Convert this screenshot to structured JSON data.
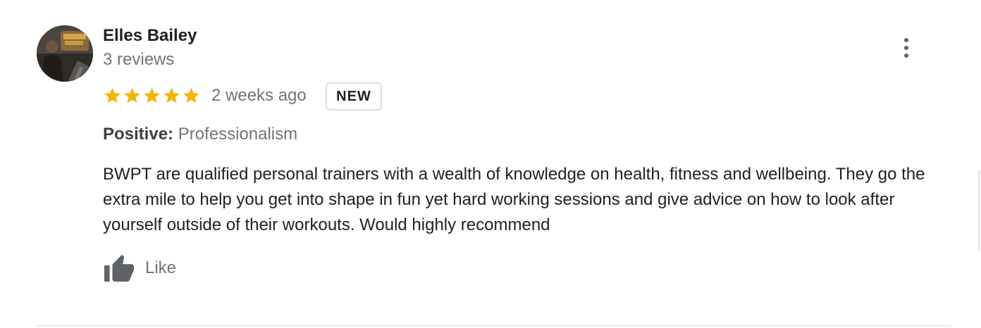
{
  "reviewer": {
    "name": "Elles Bailey",
    "review_count": "3 reviews"
  },
  "rating": {
    "stars": 5,
    "max_stars": 5,
    "star_color": "#f4b400"
  },
  "time_ago": "2 weeks ago",
  "badge": "NEW",
  "attribute": {
    "label": "Positive:",
    "value": "Professionalism"
  },
  "review_text": "BWPT are qualified personal trainers with a wealth of knowledge on health, fitness and wellbeing. They go the extra mile to help you get into shape in fun yet hard working sessions and give advice on how to look after yourself outside of their workouts. Would highly recommend",
  "actions": {
    "like_label": "Like",
    "like_icon": "thumb-up-icon",
    "more_icon": "more-vert-icon"
  },
  "colors": {
    "primary_text": "#202124",
    "secondary_text": "#70757a",
    "icon_gray": "#5f6368"
  }
}
